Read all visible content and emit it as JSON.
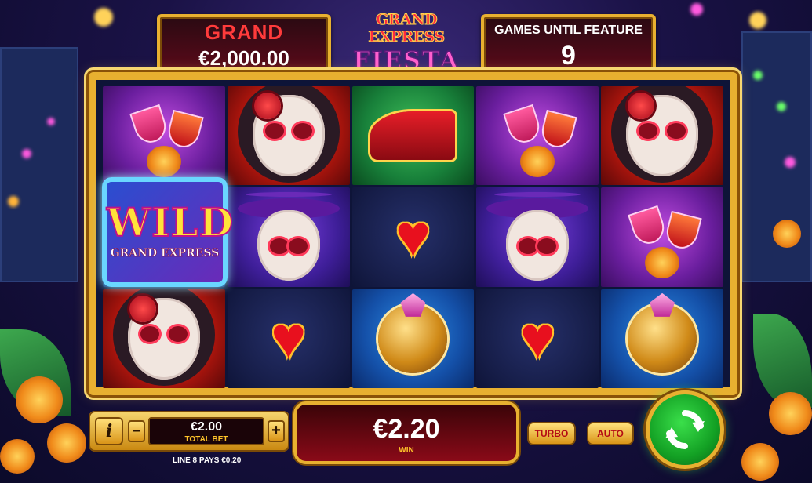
{
  "jackpot": {
    "label": "GRAND",
    "value": "€2,000.00"
  },
  "feature": {
    "label": "GAMES UNTIL FEATURE",
    "value": "9"
  },
  "logo": {
    "line1": "GRAND EXPRESS",
    "line2": "FIESTA"
  },
  "reels": [
    [
      "cocktails",
      "catrina",
      "piano",
      "cocktails",
      "catrina"
    ],
    [
      "wild",
      "catrin",
      "heart",
      "catrin",
      "cocktails"
    ],
    [
      "catrina",
      "heart",
      "gem-skull",
      "heart",
      "gem-skull"
    ]
  ],
  "wild": {
    "label": "WILD",
    "sub": "GRAND EXPRESS"
  },
  "bet": {
    "value": "€2.00",
    "label": "TOTAL BET",
    "minus": "–",
    "plus": "+",
    "info": "i"
  },
  "win": {
    "value": "€2.20",
    "label": "WIN"
  },
  "line_pays": "LINE 8 PAYS €0.20",
  "buttons": {
    "turbo": "TURBO",
    "auto": "AUTO"
  },
  "colors": {
    "gold": "#e8b030",
    "jackpot_red": "#ff3b3b",
    "spin_green": "#13a024"
  }
}
